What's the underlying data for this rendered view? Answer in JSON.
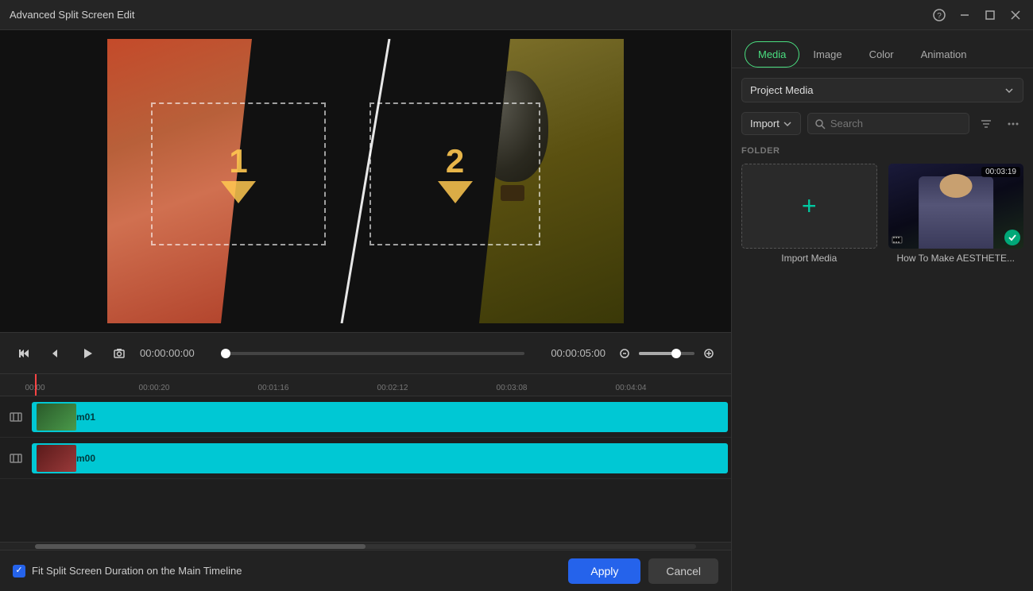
{
  "titleBar": {
    "title": "Advanced Split Screen Edit",
    "helpBtn": "?",
    "minimizeBtn": "–",
    "maximizeBtn": "□",
    "closeBtn": "✕"
  },
  "playback": {
    "currentTime": "00:00:00:00",
    "totalTime": "00:00:05:00"
  },
  "timeline": {
    "tracks": [
      {
        "id": "track1",
        "label": "m01",
        "thumbType": "green"
      },
      {
        "id": "track2",
        "label": "m00",
        "thumbType": "red"
      }
    ],
    "rulerMarks": [
      {
        "time": "00:00",
        "offset": 0
      },
      {
        "time": "00:00:20",
        "offset": 150
      },
      {
        "time": "00:01:16",
        "offset": 300
      },
      {
        "time": "00:02:12",
        "offset": 450
      },
      {
        "time": "00:03:08",
        "offset": 600
      },
      {
        "time": "00:04:04",
        "offset": 750
      }
    ]
  },
  "bottomBar": {
    "checkboxLabel": "Fit Split Screen Duration on the Main Timeline",
    "applyBtn": "Apply",
    "cancelBtn": "Cancel"
  },
  "rightPanel": {
    "tabs": [
      {
        "id": "media",
        "label": "Media",
        "active": true
      },
      {
        "id": "image",
        "label": "Image",
        "active": false
      },
      {
        "id": "color",
        "label": "Color",
        "active": false
      },
      {
        "id": "animation",
        "label": "Animation",
        "active": false
      }
    ],
    "dropdown": "Project Media",
    "importBtn": "Import",
    "searchPlaceholder": "Search",
    "folderLabel": "FOLDER",
    "mediaItems": [
      {
        "id": "import",
        "type": "import",
        "label": "Import Media"
      },
      {
        "id": "video1",
        "type": "video",
        "label": "How To Make AESTHETE...",
        "duration": "00:03:19",
        "hasCheck": true
      }
    ]
  },
  "preview": {
    "slot1Label": "1",
    "slot2Label": "2"
  }
}
